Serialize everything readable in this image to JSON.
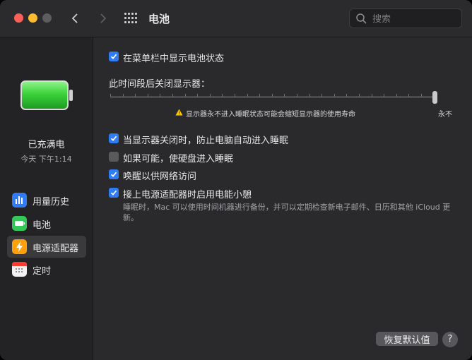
{
  "window": {
    "title": "电池"
  },
  "search": {
    "placeholder": "搜索"
  },
  "battery_status": {
    "title": "已充满电",
    "time": "今天 下午1:14"
  },
  "sidebar": {
    "items": [
      {
        "label": "用量历史",
        "icon": "bar-chart-icon",
        "color": "#2f7cf6"
      },
      {
        "label": "电池",
        "icon": "battery-icon",
        "color": "#34c759"
      },
      {
        "label": "电源适配器",
        "icon": "lightning-icon",
        "color": "#ff9f0a",
        "active": true
      },
      {
        "label": "定时",
        "icon": "calendar-icon",
        "color": "#f2f2f2"
      }
    ]
  },
  "settings": {
    "show_in_menubar": {
      "label": "在菜单栏中显示电池状态",
      "checked": true
    },
    "display_off_label": "此时间段后关闭显示器：",
    "display_off_value": "永不",
    "warning": "显示器永不进入睡眠状态可能会缩短显示器的使用寿命",
    "prevent_sleep": {
      "label": "当显示器关闭时，防止电脑自动进入睡眠",
      "checked": true
    },
    "hard_disk_sleep": {
      "label": "如果可能，使硬盘进入睡眠",
      "checked": false
    },
    "wake_network": {
      "label": "唤醒以供网络访问",
      "checked": true
    },
    "power_nap": {
      "label": "接上电源适配器时启用电能小憩",
      "checked": true
    },
    "power_nap_note": "睡眠时，Mac 可以使用时间机器进行备份，并可以定期检查新电子邮件、日历和其他 iCloud 更新。"
  },
  "buttons": {
    "restore_defaults": "恢复默认值",
    "help": "?"
  },
  "colors": {
    "accent": "#2f7cf6",
    "battery_green": "#3ad33a"
  }
}
